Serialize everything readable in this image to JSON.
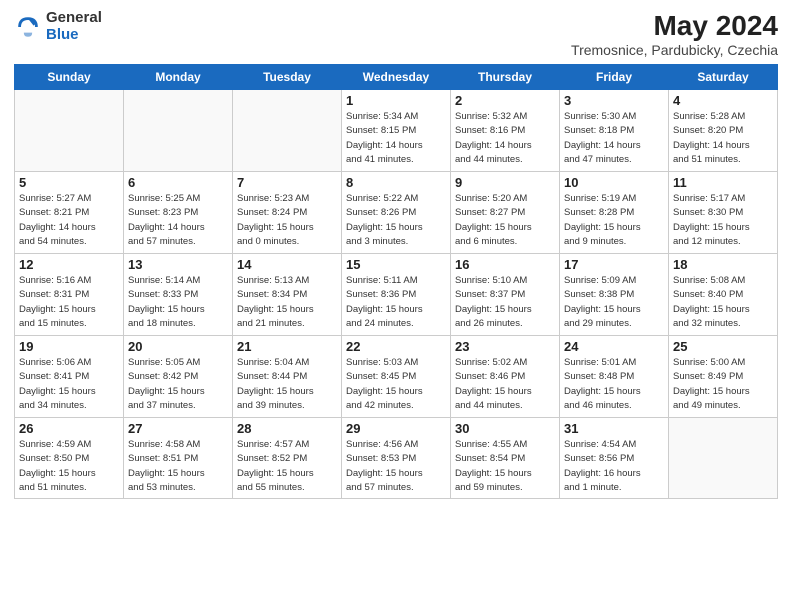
{
  "logo": {
    "general": "General",
    "blue": "Blue"
  },
  "title": "May 2024",
  "subtitle": "Tremosnice, Pardubicky, Czechia",
  "days_of_week": [
    "Sunday",
    "Monday",
    "Tuesday",
    "Wednesday",
    "Thursday",
    "Friday",
    "Saturday"
  ],
  "weeks": [
    [
      {
        "day": "",
        "info": ""
      },
      {
        "day": "",
        "info": ""
      },
      {
        "day": "",
        "info": ""
      },
      {
        "day": "1",
        "info": "Sunrise: 5:34 AM\nSunset: 8:15 PM\nDaylight: 14 hours\nand 41 minutes."
      },
      {
        "day": "2",
        "info": "Sunrise: 5:32 AM\nSunset: 8:16 PM\nDaylight: 14 hours\nand 44 minutes."
      },
      {
        "day": "3",
        "info": "Sunrise: 5:30 AM\nSunset: 8:18 PM\nDaylight: 14 hours\nand 47 minutes."
      },
      {
        "day": "4",
        "info": "Sunrise: 5:28 AM\nSunset: 8:20 PM\nDaylight: 14 hours\nand 51 minutes."
      }
    ],
    [
      {
        "day": "5",
        "info": "Sunrise: 5:27 AM\nSunset: 8:21 PM\nDaylight: 14 hours\nand 54 minutes."
      },
      {
        "day": "6",
        "info": "Sunrise: 5:25 AM\nSunset: 8:23 PM\nDaylight: 14 hours\nand 57 minutes."
      },
      {
        "day": "7",
        "info": "Sunrise: 5:23 AM\nSunset: 8:24 PM\nDaylight: 15 hours\nand 0 minutes."
      },
      {
        "day": "8",
        "info": "Sunrise: 5:22 AM\nSunset: 8:26 PM\nDaylight: 15 hours\nand 3 minutes."
      },
      {
        "day": "9",
        "info": "Sunrise: 5:20 AM\nSunset: 8:27 PM\nDaylight: 15 hours\nand 6 minutes."
      },
      {
        "day": "10",
        "info": "Sunrise: 5:19 AM\nSunset: 8:28 PM\nDaylight: 15 hours\nand 9 minutes."
      },
      {
        "day": "11",
        "info": "Sunrise: 5:17 AM\nSunset: 8:30 PM\nDaylight: 15 hours\nand 12 minutes."
      }
    ],
    [
      {
        "day": "12",
        "info": "Sunrise: 5:16 AM\nSunset: 8:31 PM\nDaylight: 15 hours\nand 15 minutes."
      },
      {
        "day": "13",
        "info": "Sunrise: 5:14 AM\nSunset: 8:33 PM\nDaylight: 15 hours\nand 18 minutes."
      },
      {
        "day": "14",
        "info": "Sunrise: 5:13 AM\nSunset: 8:34 PM\nDaylight: 15 hours\nand 21 minutes."
      },
      {
        "day": "15",
        "info": "Sunrise: 5:11 AM\nSunset: 8:36 PM\nDaylight: 15 hours\nand 24 minutes."
      },
      {
        "day": "16",
        "info": "Sunrise: 5:10 AM\nSunset: 8:37 PM\nDaylight: 15 hours\nand 26 minutes."
      },
      {
        "day": "17",
        "info": "Sunrise: 5:09 AM\nSunset: 8:38 PM\nDaylight: 15 hours\nand 29 minutes."
      },
      {
        "day": "18",
        "info": "Sunrise: 5:08 AM\nSunset: 8:40 PM\nDaylight: 15 hours\nand 32 minutes."
      }
    ],
    [
      {
        "day": "19",
        "info": "Sunrise: 5:06 AM\nSunset: 8:41 PM\nDaylight: 15 hours\nand 34 minutes."
      },
      {
        "day": "20",
        "info": "Sunrise: 5:05 AM\nSunset: 8:42 PM\nDaylight: 15 hours\nand 37 minutes."
      },
      {
        "day": "21",
        "info": "Sunrise: 5:04 AM\nSunset: 8:44 PM\nDaylight: 15 hours\nand 39 minutes."
      },
      {
        "day": "22",
        "info": "Sunrise: 5:03 AM\nSunset: 8:45 PM\nDaylight: 15 hours\nand 42 minutes."
      },
      {
        "day": "23",
        "info": "Sunrise: 5:02 AM\nSunset: 8:46 PM\nDaylight: 15 hours\nand 44 minutes."
      },
      {
        "day": "24",
        "info": "Sunrise: 5:01 AM\nSunset: 8:48 PM\nDaylight: 15 hours\nand 46 minutes."
      },
      {
        "day": "25",
        "info": "Sunrise: 5:00 AM\nSunset: 8:49 PM\nDaylight: 15 hours\nand 49 minutes."
      }
    ],
    [
      {
        "day": "26",
        "info": "Sunrise: 4:59 AM\nSunset: 8:50 PM\nDaylight: 15 hours\nand 51 minutes."
      },
      {
        "day": "27",
        "info": "Sunrise: 4:58 AM\nSunset: 8:51 PM\nDaylight: 15 hours\nand 53 minutes."
      },
      {
        "day": "28",
        "info": "Sunrise: 4:57 AM\nSunset: 8:52 PM\nDaylight: 15 hours\nand 55 minutes."
      },
      {
        "day": "29",
        "info": "Sunrise: 4:56 AM\nSunset: 8:53 PM\nDaylight: 15 hours\nand 57 minutes."
      },
      {
        "day": "30",
        "info": "Sunrise: 4:55 AM\nSunset: 8:54 PM\nDaylight: 15 hours\nand 59 minutes."
      },
      {
        "day": "31",
        "info": "Sunrise: 4:54 AM\nSunset: 8:56 PM\nDaylight: 16 hours\nand 1 minute."
      },
      {
        "day": "",
        "info": ""
      }
    ]
  ]
}
